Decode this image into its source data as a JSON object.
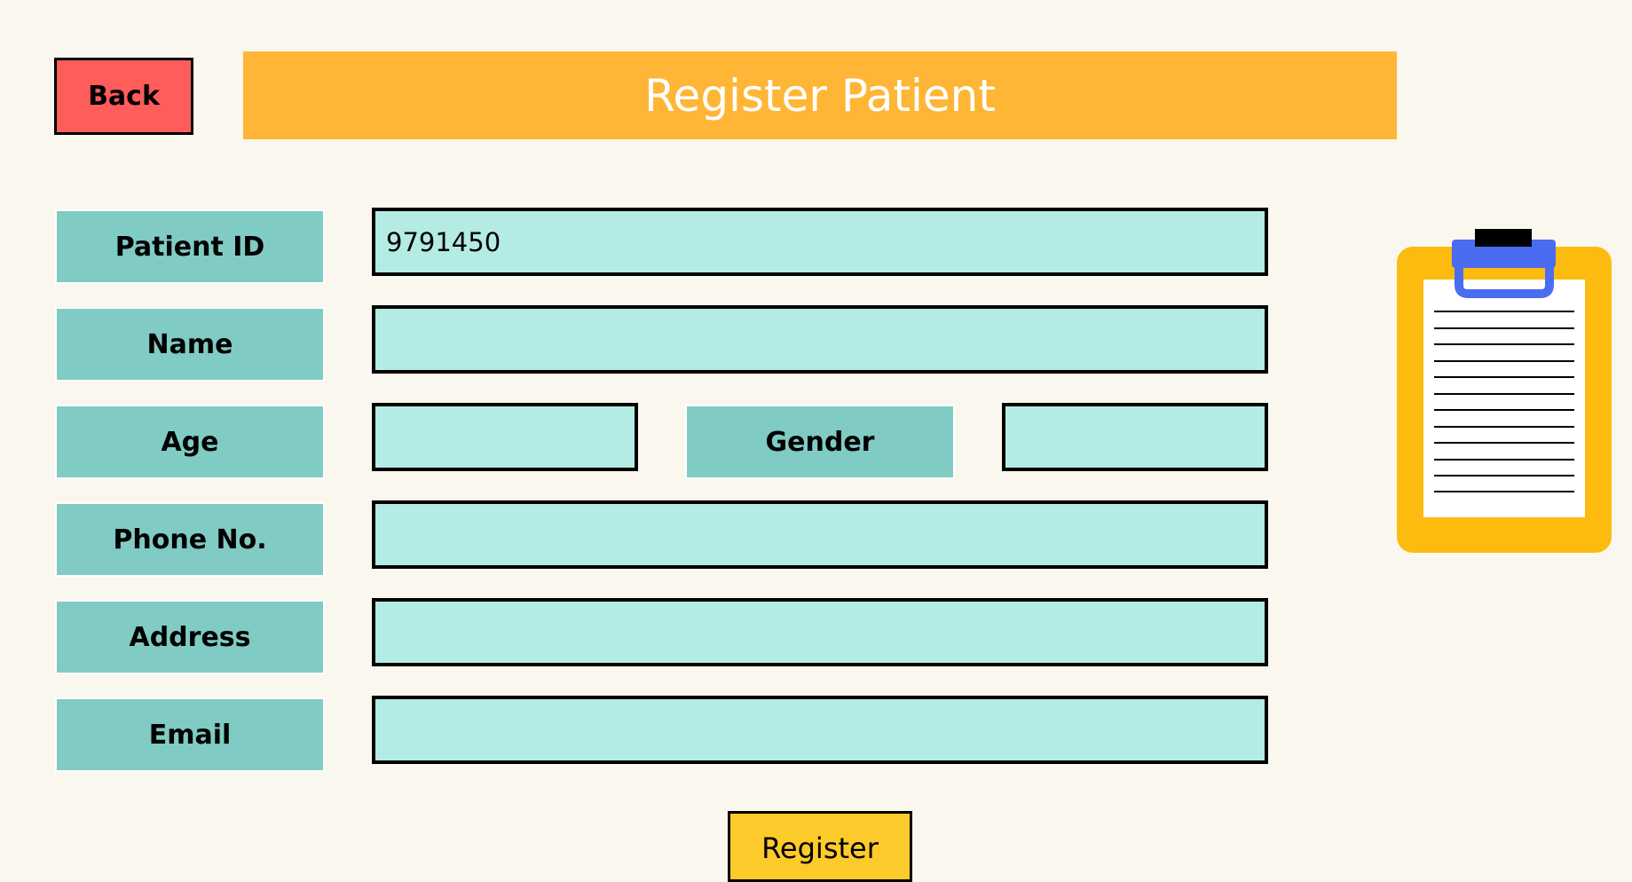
{
  "header": {
    "back_label": "Back",
    "title": "Register Patient"
  },
  "form": {
    "patient_id": {
      "label": "Patient ID",
      "value": "9791450"
    },
    "name": {
      "label": "Name",
      "value": ""
    },
    "age": {
      "label": "Age",
      "value": ""
    },
    "gender": {
      "label": "Gender",
      "value": ""
    },
    "phone": {
      "label": "Phone No.",
      "value": ""
    },
    "address": {
      "label": "Address",
      "value": ""
    },
    "email": {
      "label": "Email",
      "value": ""
    },
    "register_label": "Register"
  },
  "colors": {
    "background": "#faf7ef",
    "back_button": "#ff5c5c",
    "header": "#ffb535",
    "label": "#80cbc4",
    "field": "#b4ebe5",
    "register_button": "#fdca2c",
    "clipboard_board": "#fdbb0f",
    "clipboard_clip": "#4a6cf0"
  },
  "icons": {
    "illustration": "clipboard-icon"
  }
}
